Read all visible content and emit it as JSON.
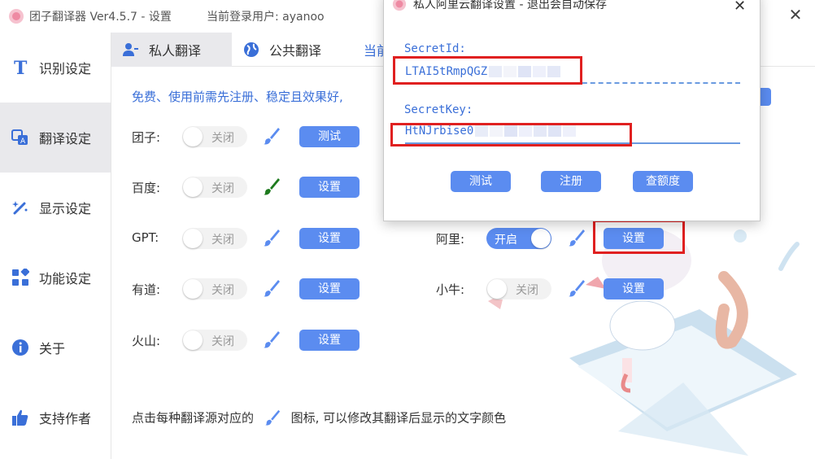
{
  "window": {
    "title": "团子翻译器 Ver4.5.7 - 设置",
    "user_label": "当前登录用户: ayanoo",
    "close_glyph": "✕"
  },
  "sidebar": {
    "items": [
      {
        "label": "识别设定",
        "icon": "text-T-icon"
      },
      {
        "label": "翻译设定",
        "icon": "translate-icon",
        "active": true
      },
      {
        "label": "显示设定",
        "icon": "magic-wand-icon"
      },
      {
        "label": "功能设定",
        "icon": "apps-grid-icon"
      },
      {
        "label": "关于",
        "icon": "info-icon"
      },
      {
        "label": "支持作者",
        "icon": "thumbs-up-icon"
      }
    ]
  },
  "tabs": [
    {
      "label": "私人翻译",
      "icon": "person-key-icon",
      "active": true
    },
    {
      "label": "公共翻译",
      "icon": "globe-icon"
    },
    {
      "label": "当前",
      "icon": ""
    }
  ],
  "main": {
    "notice": "免费、使用前需先注册、稳定且效果好,",
    "toggle_off": "关闭",
    "toggle_on": "开启",
    "rows_left": [
      {
        "label": "团子:",
        "button": "测试",
        "brush_color": "#5b8cf0"
      },
      {
        "label": "百度:",
        "button": "设置",
        "brush_color": "#1e7a1e"
      },
      {
        "label": "GPT:",
        "button": "设置",
        "brush_color": "#5b8cf0"
      },
      {
        "label": "有道:",
        "button": "设置",
        "brush_color": "#5b8cf0"
      },
      {
        "label": "火山:",
        "button": "设置",
        "brush_color": "#5b8cf0"
      }
    ],
    "rows_right": [
      {
        "label": "阿里:",
        "button": "设置",
        "enabled": true
      },
      {
        "label": "小牛:",
        "button": "设置",
        "enabled": false
      }
    ],
    "footnote_before": "点击每种翻译源对应的",
    "footnote_after": "图标, 可以修改其翻译后显示的文字颜色"
  },
  "dialog": {
    "title": "私人阿里云翻译设置 - 退出会自动保存",
    "close_glyph": "✕",
    "secret_id_label": "SecretId:",
    "secret_id_value": "LTAI5tRmpQGZ",
    "secret_key_label": "SecretKey:",
    "secret_key_value": "HtNJrbise0",
    "buttons": {
      "test": "测试",
      "register": "注册",
      "quota": "查额度"
    }
  },
  "colors": {
    "accent": "#5b8cf0",
    "highlight": "#e02020",
    "label_blue": "#3a6fd8"
  }
}
